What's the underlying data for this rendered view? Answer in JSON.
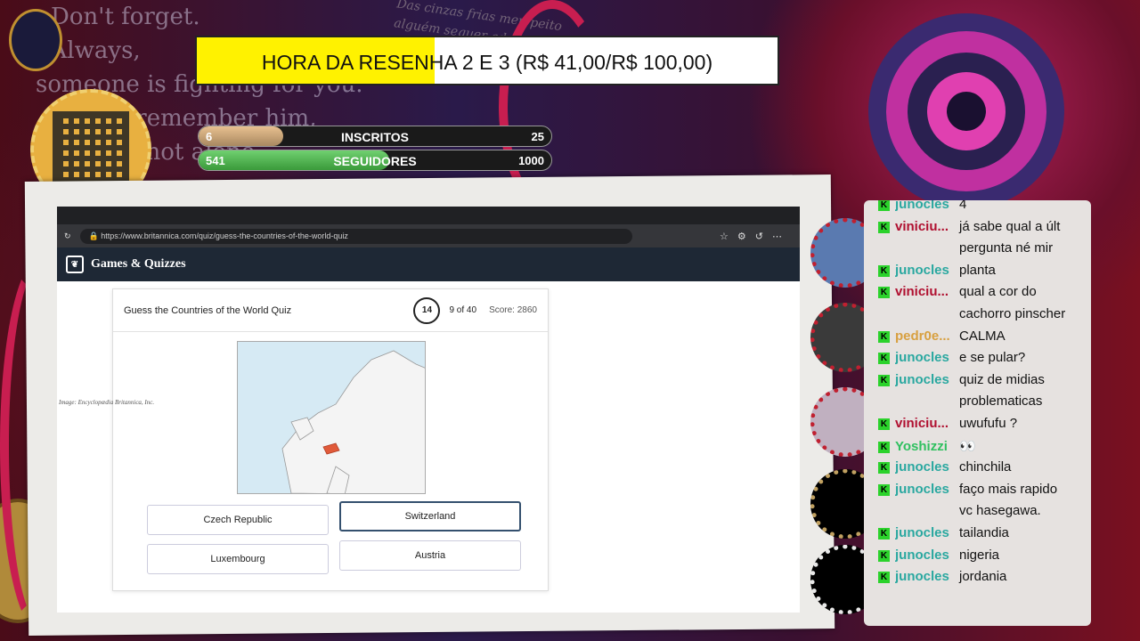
{
  "stream": {
    "bg_lines": "- Don't forget.\n  Always,\nsomeone is fighting for you.\n  As you remember him,\n  you are not alone.",
    "bg_lines_pt": "Das cinzas frias meu peito\nalguém sequer adquei\nque a vida me permita ir\nao reino de Deus",
    "goal": {
      "text": "HORA DA RESENHA 2 E 3 (R$ 41,00/R$ 100,00)",
      "progress": 0.41
    },
    "subs": {
      "current": "6",
      "label": "INSCRITOS",
      "target": "25",
      "progress": 0.24
    },
    "followers": {
      "current": "541",
      "label": "SEGUIDORES",
      "target": "1000",
      "progress": 0.541
    }
  },
  "browser": {
    "url": "https://www.britannica.com/quiz/guess-the-countries-of-the-world-quiz",
    "brand": "Games & Quizzes",
    "quiz": {
      "title": "Guess the Countries of the World Quiz",
      "timer": "14",
      "progress": "9 of 40",
      "score": "Score: 2860",
      "answers": [
        "Czech Republic",
        "Switzerland",
        "Luxembourg",
        "Austria"
      ],
      "selected": "Switzerland",
      "credit": "Image: Encyclopædia Britannica, Inc."
    }
  },
  "chat": [
    {
      "user": "junocles",
      "text": "4",
      "color": "#2aa8a0"
    },
    {
      "user": "viniciu...",
      "text": "já sabe qual a últ",
      "color": "#b01030"
    },
    {
      "user": "",
      "text": "pergunta né mir",
      "color": ""
    },
    {
      "user": "junocles",
      "text": "planta",
      "color": "#2aa8a0"
    },
    {
      "user": "viniciu...",
      "text": "qual a cor do",
      "color": "#b01030"
    },
    {
      "user": "",
      "text": "cachorro pinscher",
      "color": ""
    },
    {
      "user": "pedr0e...",
      "text": "CALMA",
      "color": "#d8a040"
    },
    {
      "user": "junocles",
      "text": "e se pular?",
      "color": "#2aa8a0"
    },
    {
      "user": "junocles",
      "text": "quiz de midias",
      "color": "#2aa8a0"
    },
    {
      "user": "",
      "text": "problematicas",
      "color": ""
    },
    {
      "user": "viniciu...",
      "text": "uwufufu ?",
      "color": "#b01030"
    },
    {
      "user": "Yoshizzi",
      "text": "👀",
      "color": "#30c060"
    },
    {
      "user": "junocles",
      "text": "chinchila",
      "color": "#2aa8a0"
    },
    {
      "user": "junocles",
      "text": "faço mais rapido",
      "color": "#2aa8a0"
    },
    {
      "user": "",
      "text": "vc hasegawa.",
      "color": ""
    },
    {
      "user": "junocles",
      "text": "tailandia",
      "color": "#2aa8a0"
    },
    {
      "user": "junocles",
      "text": "nigeria",
      "color": "#2aa8a0"
    },
    {
      "user": "junocles",
      "text": "jordania",
      "color": "#2aa8a0"
    }
  ]
}
